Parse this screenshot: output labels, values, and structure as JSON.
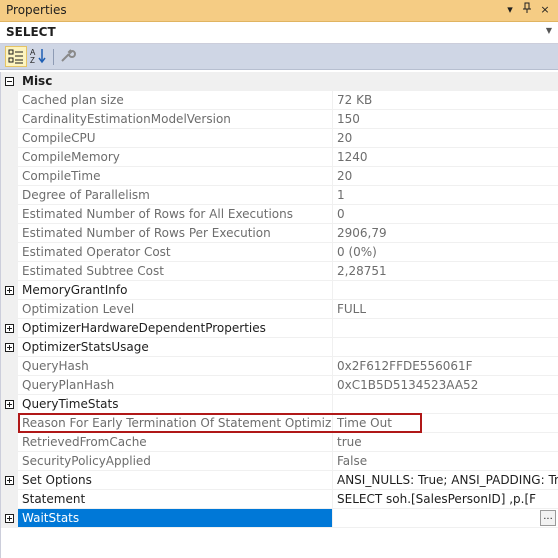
{
  "window": {
    "title": "Properties",
    "pin_glyph": "▾",
    "autohide_glyph": "┅",
    "close_glyph": "×"
  },
  "selector": {
    "value": "SELECT",
    "dropdown_glyph": "▼"
  },
  "toolbar": {
    "categorized_icon": "categorized-icon",
    "alphabetical_icon": "alphabetical-icon",
    "property_pages_icon": "wrench-icon"
  },
  "grid": {
    "category": {
      "name": "Misc"
    },
    "rows": [
      {
        "name": "Cached plan size",
        "value": "72 KB",
        "readonly": true,
        "expander": false
      },
      {
        "name": "CardinalityEstimationModelVersion",
        "value": "150",
        "readonly": true,
        "expander": false
      },
      {
        "name": "CompileCPU",
        "value": "20",
        "readonly": true,
        "expander": false
      },
      {
        "name": "CompileMemory",
        "value": "1240",
        "readonly": true,
        "expander": false
      },
      {
        "name": "CompileTime",
        "value": "20",
        "readonly": true,
        "expander": false
      },
      {
        "name": "Degree of Parallelism",
        "value": "1",
        "readonly": true,
        "expander": false
      },
      {
        "name": "Estimated Number of Rows for All Executions",
        "value": "0",
        "readonly": true,
        "expander": false
      },
      {
        "name": "Estimated Number of Rows Per Execution",
        "value": "2906,79",
        "readonly": true,
        "expander": false
      },
      {
        "name": "Estimated Operator Cost",
        "value": "0 (0%)",
        "readonly": true,
        "expander": false
      },
      {
        "name": "Estimated Subtree Cost",
        "value": "2,28751",
        "readonly": true,
        "expander": false
      },
      {
        "name": "MemoryGrantInfo",
        "value": "",
        "readonly": false,
        "expander": true
      },
      {
        "name": "Optimization Level",
        "value": "FULL",
        "readonly": true,
        "expander": false
      },
      {
        "name": "OptimizerHardwareDependentProperties",
        "value": "",
        "readonly": false,
        "expander": true
      },
      {
        "name": "OptimizerStatsUsage",
        "value": "",
        "readonly": false,
        "expander": true
      },
      {
        "name": "QueryHash",
        "value": "0x2F612FFDE556061F",
        "readonly": true,
        "expander": false
      },
      {
        "name": "QueryPlanHash",
        "value": "0xC1B5D5134523AA52",
        "readonly": true,
        "expander": false
      },
      {
        "name": "QueryTimeStats",
        "value": "",
        "readonly": false,
        "expander": true
      },
      {
        "name": "Reason For Early Termination Of Statement Optimization",
        "value": "Time Out",
        "readonly": true,
        "expander": false
      },
      {
        "name": "RetrievedFromCache",
        "value": "true",
        "readonly": true,
        "expander": false
      },
      {
        "name": "SecurityPolicyApplied",
        "value": "False",
        "readonly": true,
        "expander": false
      },
      {
        "name": "Set Options",
        "value": "ANSI_NULLS: True; ANSI_PADDING: True; ...",
        "readonly": false,
        "expander": true
      },
      {
        "name": "Statement",
        "value": "SELECT          soh.[SalesPersonID]          ,p.[F",
        "readonly": false,
        "expander": false
      },
      {
        "name": "WaitStats",
        "value": "",
        "readonly": false,
        "expander": true,
        "selected": true
      }
    ],
    "ellipsis_label": "..."
  }
}
